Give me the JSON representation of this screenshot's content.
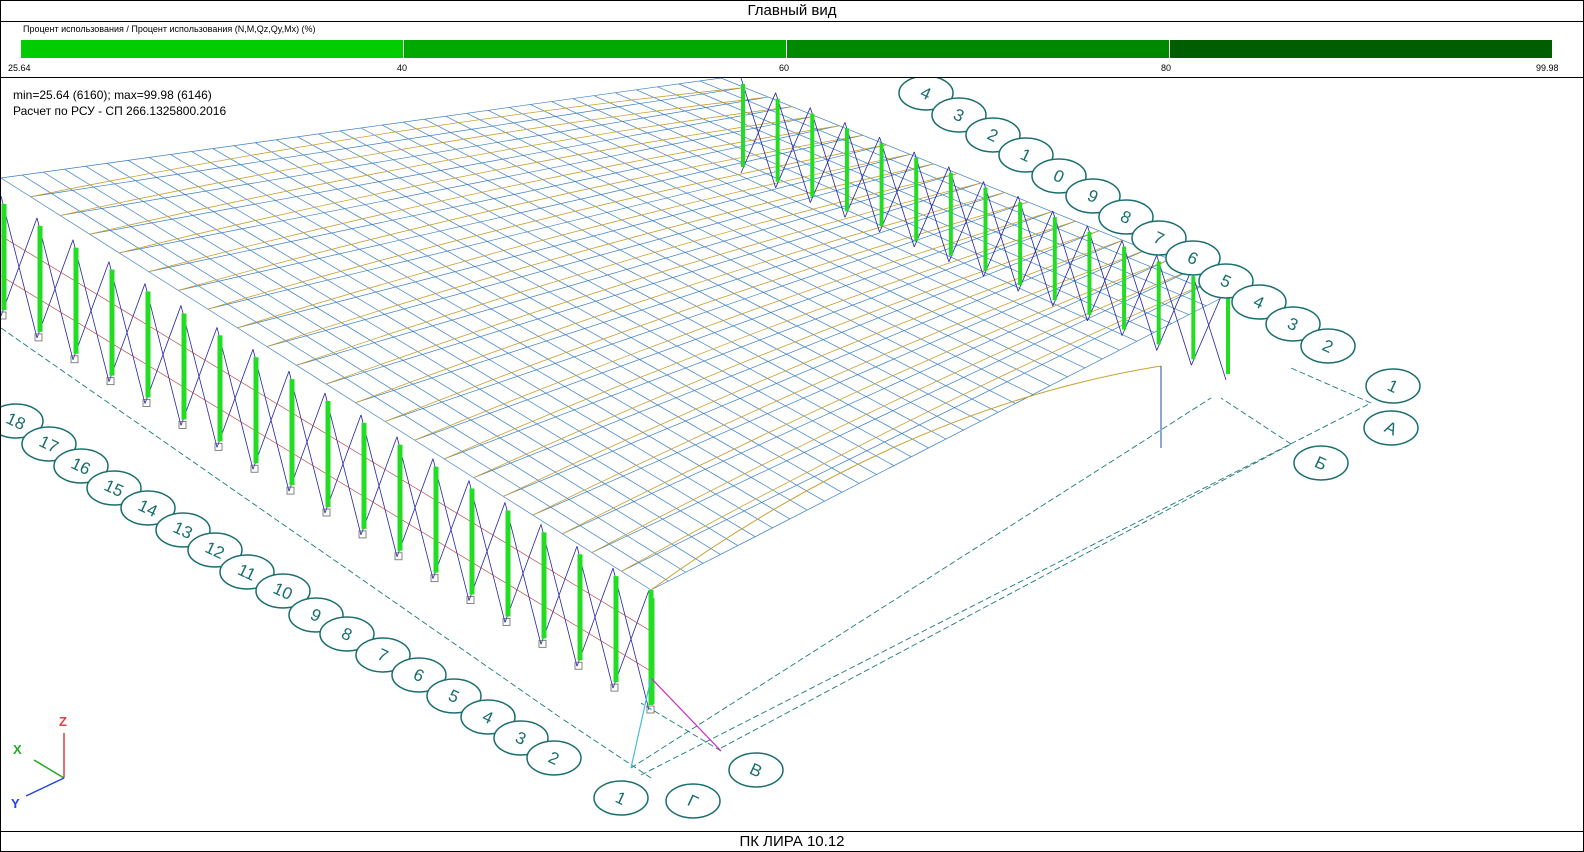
{
  "window": {
    "title": "Главный вид",
    "footer": "ПК ЛИРА 10.12"
  },
  "legend": {
    "caption": "Процент использования / Процент использования (N,M,Qz,Qy,Mx) (%)",
    "ticks": [
      "25.64",
      "40",
      "60",
      "80",
      "99.98"
    ],
    "colors": [
      "#00cc00",
      "#00a800",
      "#008800",
      "#005e00"
    ]
  },
  "info": {
    "line1": "min=25.64 (6160); max=99.98 (6146)",
    "line2": "Расчет по РСУ - СП 266.1325800.2016"
  },
  "axes": {
    "x": "X",
    "y": "Y",
    "z": "Z"
  },
  "grid_numbers_left": [
    "18",
    "17",
    "16",
    "15",
    "14",
    "13",
    "12",
    "11",
    "10",
    "9",
    "8",
    "7",
    "6",
    "5",
    "4",
    "3",
    "2",
    "1"
  ],
  "grid_numbers_right": [
    "4",
    "3",
    "2",
    "1",
    "0",
    "9",
    "8",
    "7",
    "6",
    "5",
    "4",
    "3",
    "2",
    "1"
  ],
  "grid_letters": [
    "А",
    "Б",
    "В",
    "Г"
  ],
  "colors": {
    "mesh": "#3a7fc4",
    "axis_line": "#1a7a7a",
    "column": "#22dd22",
    "bracing": "#2222aa",
    "rafter": "#c8a030"
  }
}
